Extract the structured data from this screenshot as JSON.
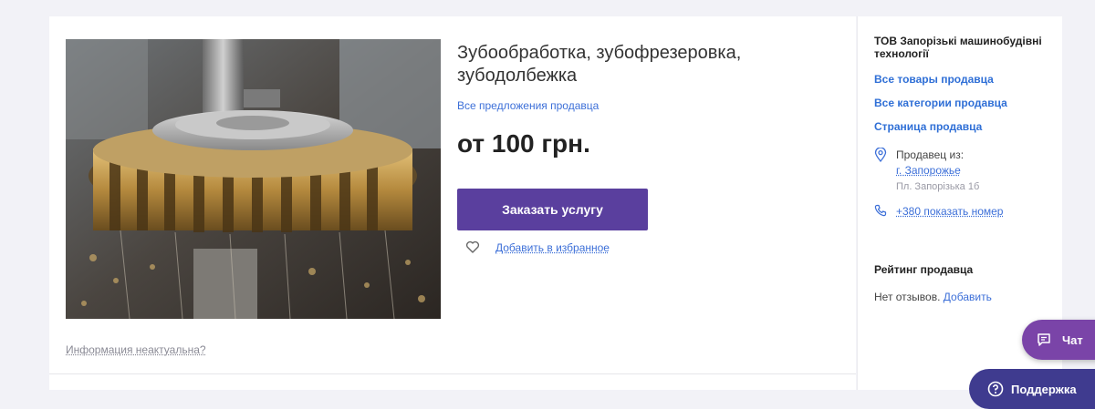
{
  "listing": {
    "title": "Зубообработка, зубофрезеровка, зубодолбежка",
    "all_offers_link": "Все предложения продавца",
    "price": "от 100 грн.",
    "order_button": "Заказать услугу",
    "favorite_link": "Добавить в избранное",
    "stale_info_link": "Информация неактуальна?"
  },
  "seller": {
    "name": "ТОВ Запорізькі машинобудівні технології",
    "links": [
      "Все товары продавца",
      "Все категории продавца",
      "Страница продавца"
    ],
    "from_label": "Продавец из:",
    "city": "г. Запорожье",
    "address": "Пл. Запорізька 1б",
    "phone": "+380 показать номер",
    "rating_title": "Рейтинг продавца",
    "no_reviews": "Нет отзывов.",
    "add_review": "Добавить"
  },
  "floating": {
    "chat": "Чат",
    "support": "Поддержка"
  },
  "colors": {
    "accent_purple": "#5a3f9e",
    "link_blue": "#3c6fd8",
    "chat_purple": "#7a44a8",
    "support_indigo": "#3f3b8f"
  },
  "icons": {
    "favorite": "heart-outline-icon",
    "location": "map-pin-icon",
    "phone": "phone-icon",
    "chat": "chat-bubble-icon",
    "support": "question-circle-icon"
  }
}
